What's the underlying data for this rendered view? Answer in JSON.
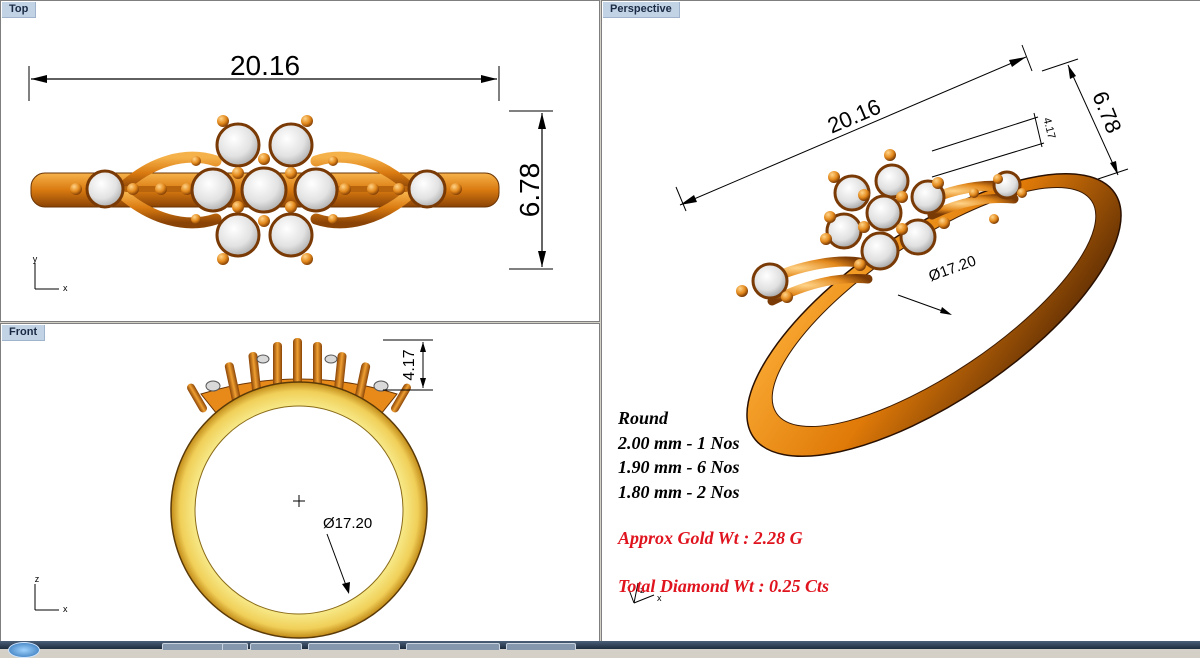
{
  "viewports": {
    "top": {
      "title": "Top",
      "axis_y": "y",
      "axis_x": "x"
    },
    "front": {
      "title": "Front",
      "axis_y": "z",
      "axis_x": "x"
    },
    "perspective": {
      "title": "Perspective",
      "axis_y": "z",
      "axis_x": "x"
    }
  },
  "dimensions": {
    "length": "20.16",
    "width": "6.78",
    "height": "4.17",
    "diameter": "Ø17.20"
  },
  "specs": {
    "heading": "Round",
    "lines": [
      "2.00 mm - 1 Nos",
      "1.90 mm - 6 Nos",
      "1.80 mm - 2 Nos"
    ],
    "gold": "Approx Gold Wt : 2.28 G",
    "diamond": "Total Diamond Wt : 0.25 Cts"
  },
  "colors": {
    "gold": "#e88a1a",
    "gold_dark": "#7a3a05",
    "gold_inner": "#f4e27a",
    "diamond": "#e8e8e8",
    "viewport_tab": "#c3d3e6",
    "spec_red": "#e0141e"
  }
}
